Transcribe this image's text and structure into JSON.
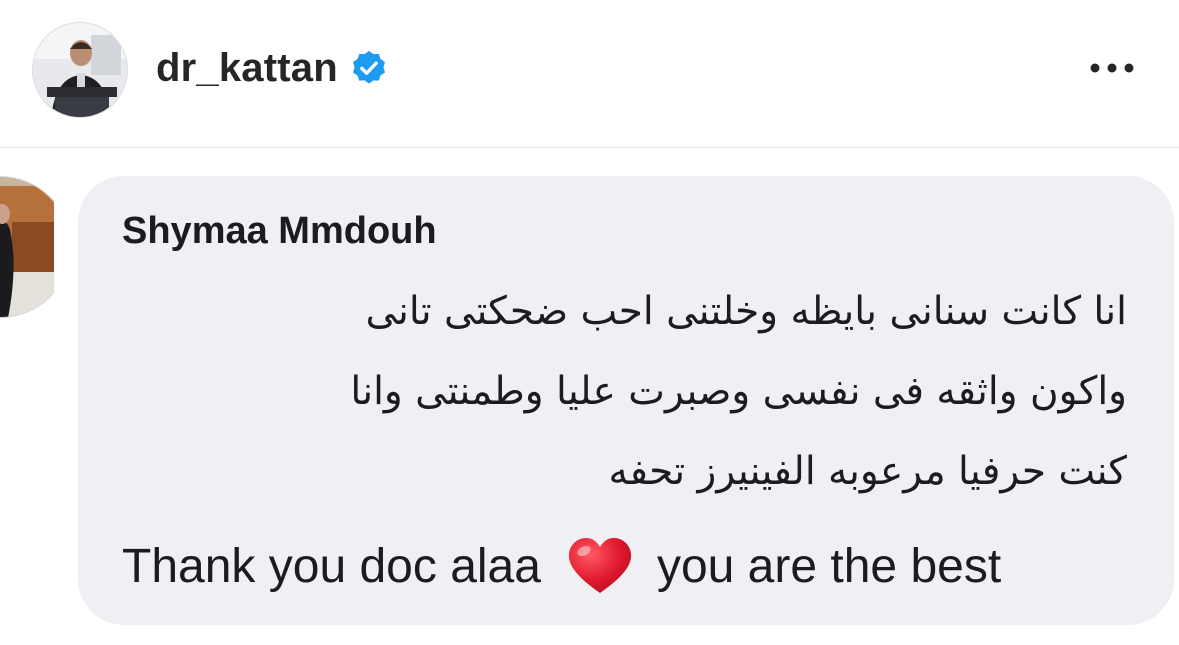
{
  "post": {
    "username": "dr_kattan",
    "verified": true,
    "avatar_icon": "profile-photo",
    "more_icon": "more-options-icon"
  },
  "comment": {
    "author": "Shymaa Mmdouh",
    "avatar_icon": "commenter-photo",
    "lines": [
      "انا كانت سنانى بايظه وخلتنى احب ضحكتى تانى",
      "واكون واثقه فى نفسى  وصبرت عليا وطمنتى وانا",
      "كنت حرفيا مرعوبه  الفينيرز تحفه"
    ],
    "english_part1": "Thank you doc alaa",
    "emoji": "red-heart",
    "english_part2": "you are the best"
  },
  "colors": {
    "bubble": "#efeff4",
    "text": "#1c1c1e",
    "verified_blue": "#1d9bf0",
    "heart_red": "#e0182d"
  }
}
